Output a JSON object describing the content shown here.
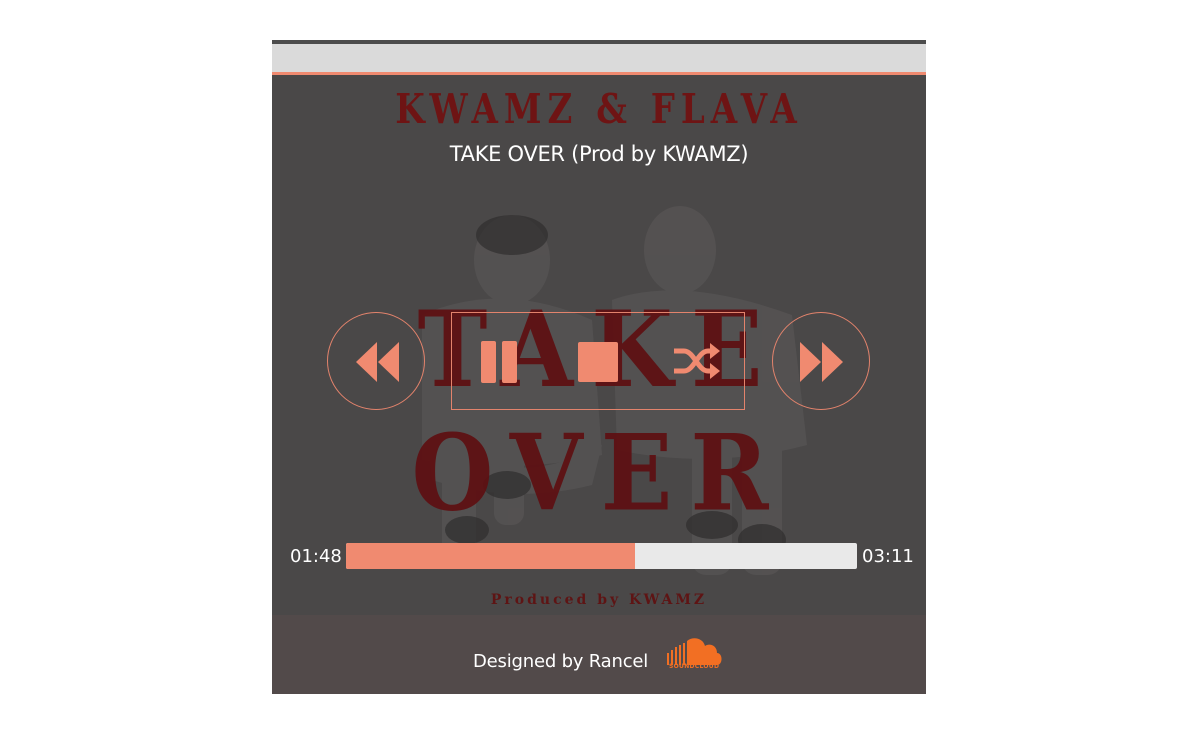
{
  "player": {
    "artist": "KWAMZ & FLAVA",
    "track_title": "TAKE OVER (Prod by KWAMZ)",
    "artwork_word": "TAKE OVER",
    "artwork_credit": "Produced by KWAMZ",
    "time_current": "01:48",
    "time_total": "03:11",
    "progress": 0.566,
    "controls": [
      "rewind-icon",
      "pause-icon",
      "stop-icon",
      "shuffle-icon",
      "fast-forward-icon"
    ]
  },
  "footer": {
    "designed_by": "Designed by Rancel",
    "brand": "SOUNDCLOUD"
  },
  "colors": {
    "accent": "#f08a70",
    "background": "#4a4848",
    "artwork_text": "#6e1414"
  }
}
